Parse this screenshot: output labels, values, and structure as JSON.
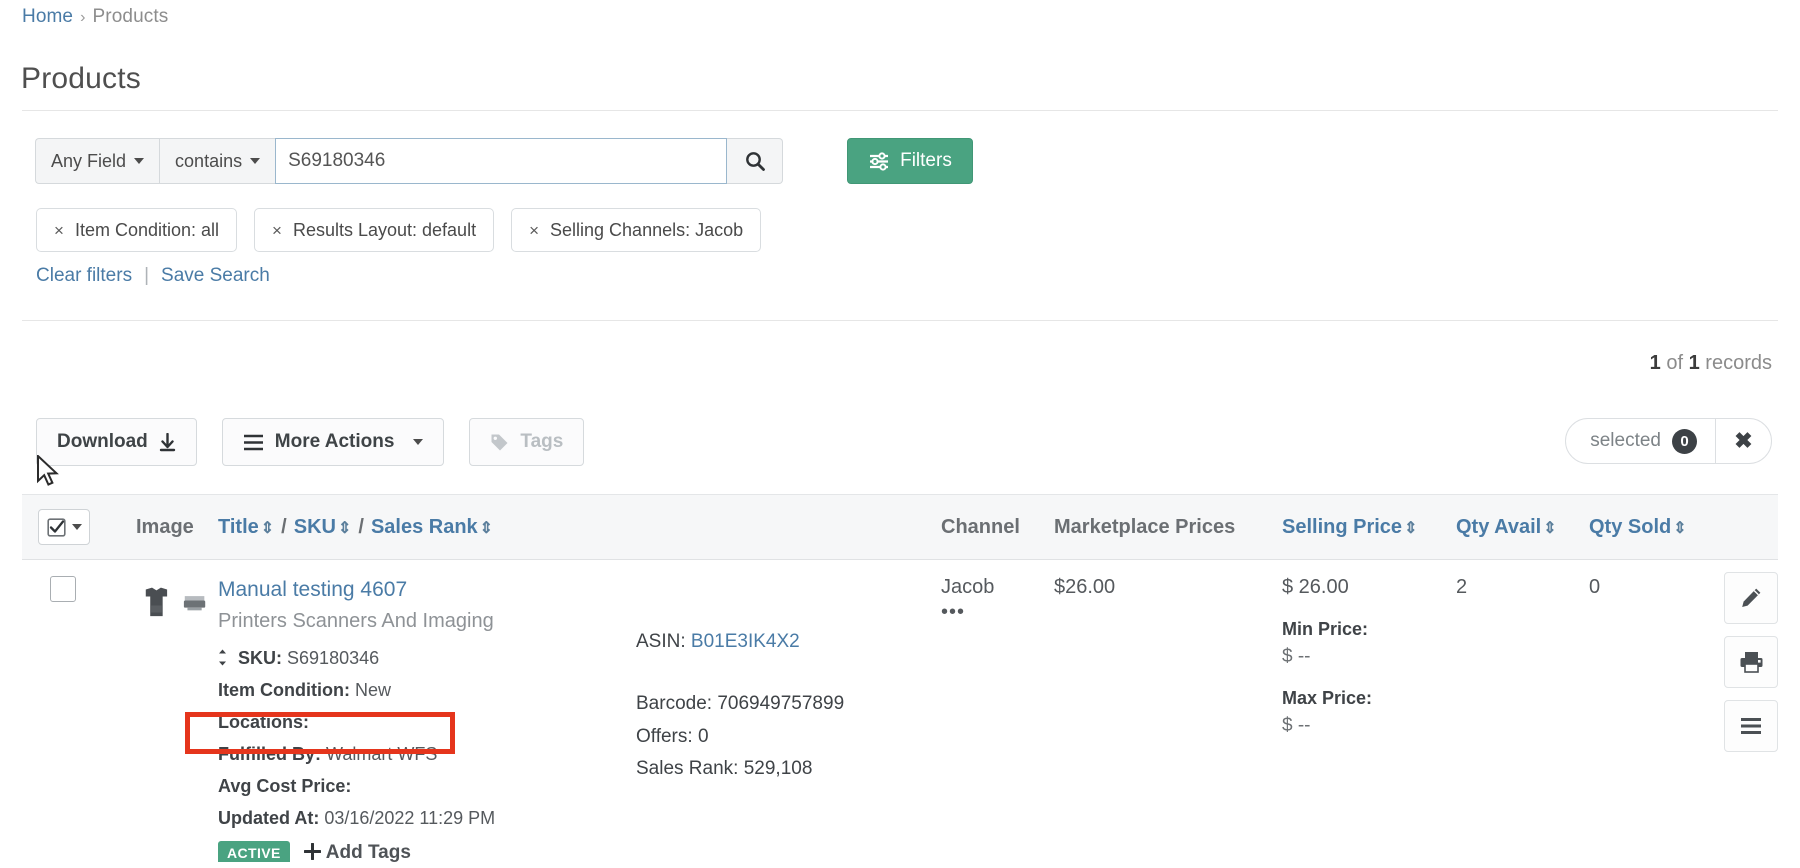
{
  "breadcrumb": {
    "home": "Home",
    "separator": "›",
    "current": "Products"
  },
  "page": {
    "title": "Products"
  },
  "search": {
    "field_selector": "Any Field",
    "operator_selector": "contains",
    "query_value": "S69180346",
    "placeholder": "",
    "search_icon": "search-icon",
    "filters_button": "Filters"
  },
  "filter_chips": [
    {
      "remove": "×",
      "label": "Item Condition: all"
    },
    {
      "remove": "×",
      "label": "Results Layout: default"
    },
    {
      "remove": "×",
      "label": "Selling Channels: Jacob"
    }
  ],
  "filter_links": {
    "clear": "Clear filters",
    "divider": "|",
    "save": "Save Search"
  },
  "records": {
    "shown": "1",
    "of": "of",
    "total": "1",
    "suffix": "records"
  },
  "toolbar": {
    "download": "Download",
    "more_actions": "More Actions",
    "tags": "Tags",
    "selected_label": "selected",
    "selected_count": "0",
    "clear_selection": "✖"
  },
  "table": {
    "headers": {
      "checkbox_dropdown": "select-all-dropdown",
      "image": "Image",
      "title": "Title",
      "sku": "SKU",
      "sales_rank": "Sales Rank",
      "slash": "/",
      "channel": "Channel",
      "marketplace_prices": "Marketplace Prices",
      "selling_price": "Selling Price",
      "qty_avail": "Qty Avail",
      "qty_sold": "Qty Sold",
      "sort_icon": "⇕"
    },
    "rows": [
      {
        "title": "Manual testing 4607",
        "category": "Printers Scanners And Imaging",
        "sku_label": "SKU:",
        "sku_value": "S69180346",
        "item_condition_label": "Item Condition:",
        "item_condition_value": "New",
        "locations_label": "Locations:",
        "locations_value": "",
        "fulfilled_by_label": "Fulfilled By:",
        "fulfilled_by_value": "Walmart WFS",
        "avg_cost_price_label": "Avg Cost Price:",
        "avg_cost_price_value": "",
        "updated_at_label": "Updated At:",
        "updated_at_value": "03/16/2022 11:29 PM",
        "status_badge": "ACTIVE",
        "add_tags": "Add Tags",
        "asin_label": "ASIN:",
        "asin_value": "B01E3IK4X2",
        "barcode_label": "Barcode:",
        "barcode_value": "706949757899",
        "offers_label": "Offers:",
        "offers_value": "0",
        "sales_rank_label": "Sales Rank:",
        "sales_rank_value": "529,108",
        "channel": "Jacob",
        "channel_more": "•••",
        "marketplace_price": "$26.00",
        "selling_price": "$  26.00",
        "min_price_label": "Min Price:",
        "min_price_value": "$ --",
        "max_price_label": "Max Price:",
        "max_price_value": "$ --",
        "qty_avail": "2",
        "qty_sold": "0",
        "actions": {
          "edit": "pencil-icon",
          "print": "printer-icon",
          "menu": "hamburger-icon"
        }
      }
    ]
  },
  "annotation": {
    "highlight_color": "#e5351c",
    "target": "Fulfilled By: Walmart WFS"
  }
}
